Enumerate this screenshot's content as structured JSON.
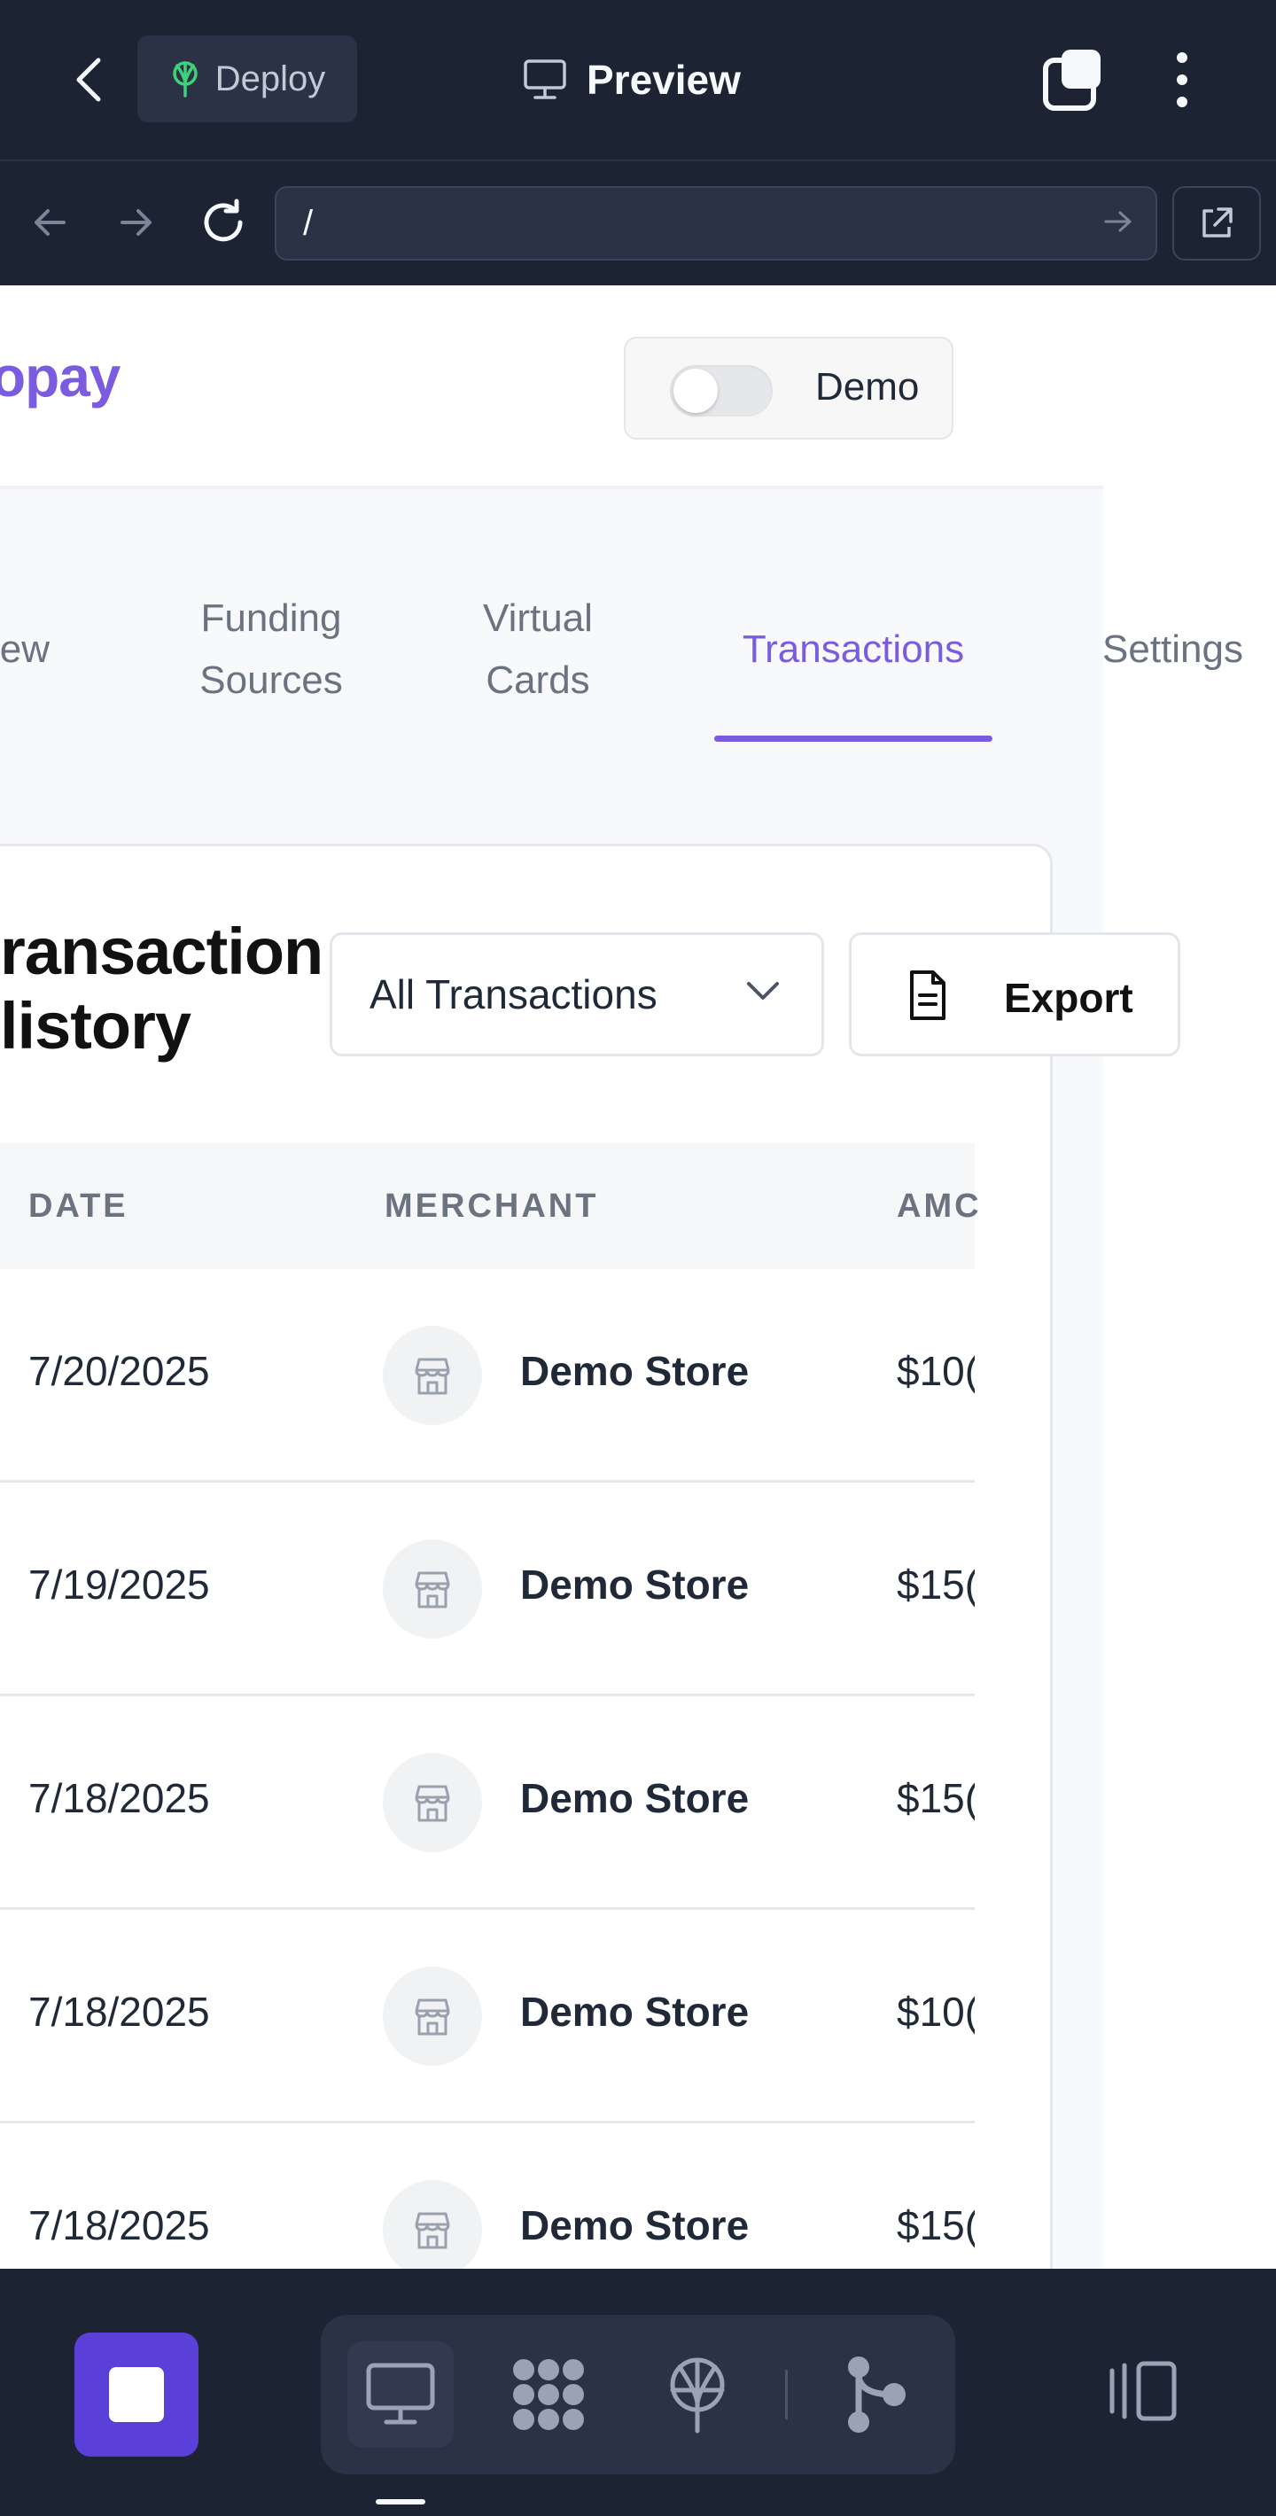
{
  "topbar": {
    "deploy_label": "Deploy",
    "title": "Preview"
  },
  "browser": {
    "url": "/"
  },
  "app": {
    "logo": "opay",
    "demo_label": "Demo",
    "demo_enabled": false,
    "tabs": [
      {
        "label": "iew"
      },
      {
        "label": "Funding\nSources"
      },
      {
        "label": "Virtual\nCards"
      },
      {
        "label": "Transactions",
        "active": true
      },
      {
        "label": "Settings"
      }
    ],
    "card_title": "ransaction\nlistory",
    "filter_value": "All Transactions",
    "export_label": "Export",
    "table": {
      "headers": [
        "DATE",
        "MERCHANT",
        "AMC"
      ],
      "rows": [
        {
          "date": "7/20/2025",
          "merchant": "Demo Store",
          "amount": "$10("
        },
        {
          "date": "7/19/2025",
          "merchant": "Demo Store",
          "amount": "$15("
        },
        {
          "date": "7/18/2025",
          "merchant": "Demo Store",
          "amount": "$15("
        },
        {
          "date": "7/18/2025",
          "merchant": "Demo Store",
          "amount": "$10("
        },
        {
          "date": "7/18/2025",
          "merchant": "Demo Store",
          "amount": "$15("
        }
      ]
    }
  },
  "colors": {
    "accent": "#7b5ce0",
    "chrome_bg": "#1c2333",
    "stop_button": "#5b3fd9"
  }
}
